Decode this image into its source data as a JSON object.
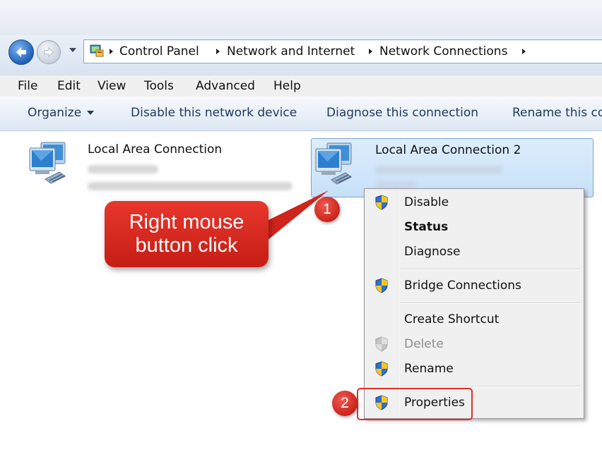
{
  "address_bar": {
    "crumbs": [
      "Control Panel",
      "Network and Internet",
      "Network Connections"
    ]
  },
  "menu": [
    "File",
    "Edit",
    "View",
    "Tools",
    "Advanced",
    "Help"
  ],
  "toolbar": {
    "organize": "Organize",
    "disable": "Disable this network device",
    "diagnose": "Diagnose this connection",
    "rename": "Rename this co"
  },
  "connections": [
    {
      "name": "Local Area Connection",
      "selected": false
    },
    {
      "name": "Local Area Connection 2",
      "selected": true
    }
  ],
  "context_menu": {
    "items": [
      {
        "label": "Disable",
        "icon": "uac-shield-icon",
        "style": "normal"
      },
      {
        "label": "Status",
        "icon": "",
        "style": "bold"
      },
      {
        "label": "Diagnose",
        "icon": "",
        "style": "normal"
      },
      {
        "label": "Bridge Connections",
        "icon": "uac-shield-icon",
        "style": "normal"
      },
      {
        "label": "Create Shortcut",
        "icon": "",
        "style": "normal"
      },
      {
        "label": "Delete",
        "icon": "uac-shield-icon",
        "style": "disabled"
      },
      {
        "label": "Rename",
        "icon": "uac-shield-icon",
        "style": "normal"
      },
      {
        "label": "Properties",
        "icon": "uac-shield-icon",
        "style": "normal"
      }
    ]
  },
  "annotations": {
    "callout_text": "Right mouse button click",
    "step1": "1",
    "step2": "2",
    "accent_color": "#d9261c"
  }
}
